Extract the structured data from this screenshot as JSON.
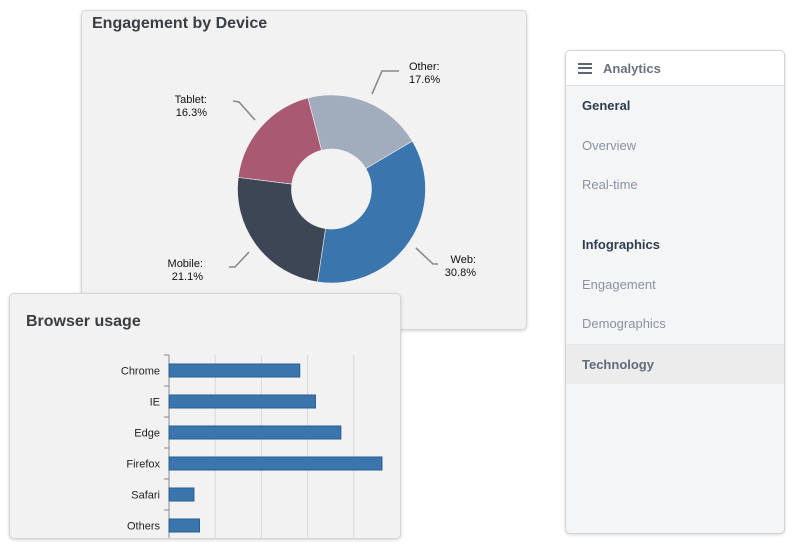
{
  "donut_card": {
    "title": "Engagement by Device"
  },
  "bar_card": {
    "title": "Browser usage"
  },
  "sidebar": {
    "title": "Analytics",
    "menu_icon": "hamburger-menu-icon",
    "groups": [
      {
        "label": "General",
        "items": [
          {
            "label": "Overview",
            "active": false
          },
          {
            "label": "Real-time",
            "active": false
          }
        ]
      },
      {
        "label": "Infographics",
        "items": [
          {
            "label": "Engagement",
            "active": false
          },
          {
            "label": "Demographics",
            "active": false
          },
          {
            "label": "Technology",
            "active": true
          }
        ]
      }
    ]
  },
  "chart_data": [
    {
      "type": "pie",
      "variant": "donut",
      "title": "Engagement by Device",
      "start_angle_deg": -14.5,
      "categories": [
        "Other",
        "Web",
        "Mobile",
        "Tablet"
      ],
      "values": [
        17.6,
        30.8,
        21.1,
        16.3
      ],
      "labels": [
        "Other:",
        "Web:",
        "Mobile:",
        "Tablet:"
      ],
      "value_labels": [
        "17.6%",
        "30.8%",
        "21.1%",
        "16.3%"
      ],
      "colors": [
        "#a1acbc",
        "#3a75ae",
        "#3d4654",
        "#a95a72"
      ]
    },
    {
      "type": "bar",
      "orientation": "horizontal",
      "title": "Browser usage",
      "categories": [
        "Chrome",
        "IE",
        "Edge",
        "Firefox",
        "Safari",
        "Others"
      ],
      "values": [
        28.3,
        31.7,
        37.2,
        46.1,
        5.4,
        6.6
      ],
      "xlim": [
        0,
        50
      ],
      "grid_step": 10,
      "grid": true,
      "tick_labels_visible": false,
      "color": "#3a75ae",
      "xlabel": "",
      "ylabel": ""
    }
  ]
}
